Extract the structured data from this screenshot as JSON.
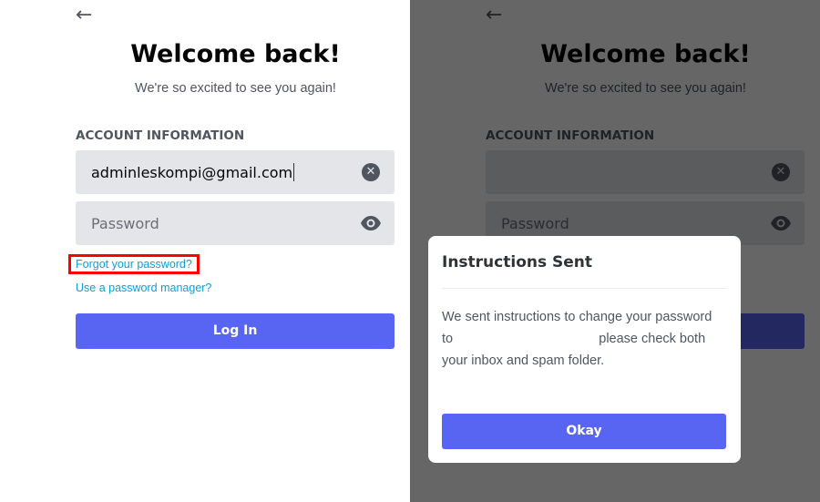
{
  "login": {
    "title": "Welcome back!",
    "subtitle": "We're so excited to see you again!",
    "section_label": "ACCOUNT INFORMATION",
    "email_value": "adminleskompi@gmail.com",
    "password_placeholder": "Password",
    "forgot_link": "Forgot your password?",
    "manager_link": "Use a password manager?",
    "login_button": "Log In"
  },
  "modal": {
    "title": "Instructions Sent",
    "body_line1": "We sent instructions to change your password",
    "body_to": "to",
    "body_line2": "please check both",
    "body_line3": "your inbox and spam folder.",
    "okay_button": "Okay"
  },
  "colors": {
    "brand": "#5865f2",
    "link": "#0a9fd8",
    "highlight": "#ff0000"
  }
}
